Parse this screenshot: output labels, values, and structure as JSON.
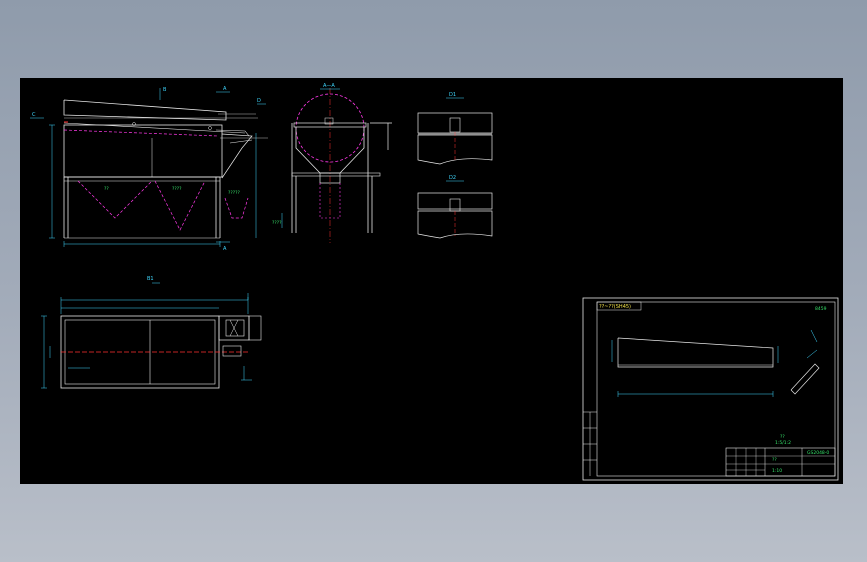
{
  "drawing": {
    "views": {
      "section_aa": "A—A",
      "view_d1": "D1",
      "view_d2": "D2",
      "view_b": "B1"
    },
    "markers": {
      "b": "B",
      "a_top": "A",
      "a_bottom": "A",
      "c": "C",
      "d": "D"
    },
    "annotations": {
      "main_mark_1": "??",
      "main_mark_2": "????",
      "main_mark_3": "?????",
      "side_mark": "????",
      "detail_note": "??",
      "detail_note2": "1:5/1:2"
    },
    "title_block": {
      "header": "??~??(SH45)",
      "part_code": "GS2048-0",
      "drawing_name": "??",
      "scale": "1:10",
      "ref": "8459"
    }
  },
  "colors": {
    "line_white": "#e8e8e8",
    "line_cyan": "#3fd8ff",
    "line_green": "#36e06a",
    "line_magenta": "#ff38e8",
    "line_red": "#ff3030",
    "line_yellow": "#f2e24a"
  }
}
